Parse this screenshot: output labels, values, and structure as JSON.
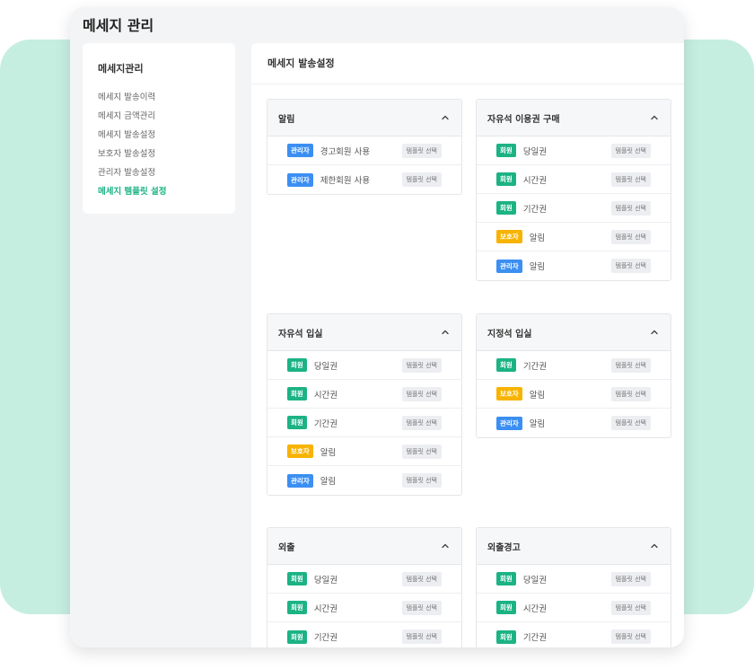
{
  "page_title": "메세지 관리",
  "sidebar": {
    "title": "메세지관리",
    "items": [
      {
        "label": "메세지 발송이력"
      },
      {
        "label": "메세지 금액관리"
      },
      {
        "label": "메세지 발송설정"
      },
      {
        "label": "보호자 발송설정"
      },
      {
        "label": "관리자 발송설정"
      },
      {
        "label": "메세지 템플릿 설정"
      }
    ]
  },
  "main": {
    "header": "메세지 발송설정",
    "template_button_label": "템플릿 선택",
    "accent_color": "#1cb384",
    "cards": [
      {
        "title": "알림",
        "rows": [
          {
            "badge": "관리자",
            "badge_type": "admin",
            "label": "경고회원 사용"
          },
          {
            "badge": "관리자",
            "badge_type": "admin",
            "label": "제한회원 사용"
          }
        ]
      },
      {
        "title": "자유석 이용권 구매",
        "rows": [
          {
            "badge": "회원",
            "badge_type": "member",
            "label": "당일권"
          },
          {
            "badge": "회원",
            "badge_type": "member",
            "label": "시간권"
          },
          {
            "badge": "회원",
            "badge_type": "member",
            "label": "기간권"
          },
          {
            "badge": "보호자",
            "badge_type": "guardian",
            "label": "알림"
          },
          {
            "badge": "관리자",
            "badge_type": "admin",
            "label": "알림"
          }
        ]
      },
      {
        "title": "자유석 입실",
        "rows": [
          {
            "badge": "회원",
            "badge_type": "member",
            "label": "당일권"
          },
          {
            "badge": "회원",
            "badge_type": "member",
            "label": "시간권"
          },
          {
            "badge": "회원",
            "badge_type": "member",
            "label": "기간권"
          },
          {
            "badge": "보호자",
            "badge_type": "guardian",
            "label": "알림"
          },
          {
            "badge": "관리자",
            "badge_type": "admin",
            "label": "알림"
          }
        ]
      },
      {
        "title": "지정석 입실",
        "rows": [
          {
            "badge": "회원",
            "badge_type": "member",
            "label": "기간권"
          },
          {
            "badge": "보호자",
            "badge_type": "guardian",
            "label": "알림"
          },
          {
            "badge": "관리자",
            "badge_type": "admin",
            "label": "알림"
          }
        ]
      },
      {
        "title": "외출",
        "rows": [
          {
            "badge": "회원",
            "badge_type": "member",
            "label": "당일권"
          },
          {
            "badge": "회원",
            "badge_type": "member",
            "label": "시간권"
          },
          {
            "badge": "회원",
            "badge_type": "member",
            "label": "기간권"
          }
        ]
      },
      {
        "title": "외출경고",
        "rows": [
          {
            "badge": "회원",
            "badge_type": "member",
            "label": "당일권"
          },
          {
            "badge": "회원",
            "badge_type": "member",
            "label": "시간권"
          },
          {
            "badge": "회원",
            "badge_type": "member",
            "label": "기간권"
          }
        ]
      }
    ]
  }
}
